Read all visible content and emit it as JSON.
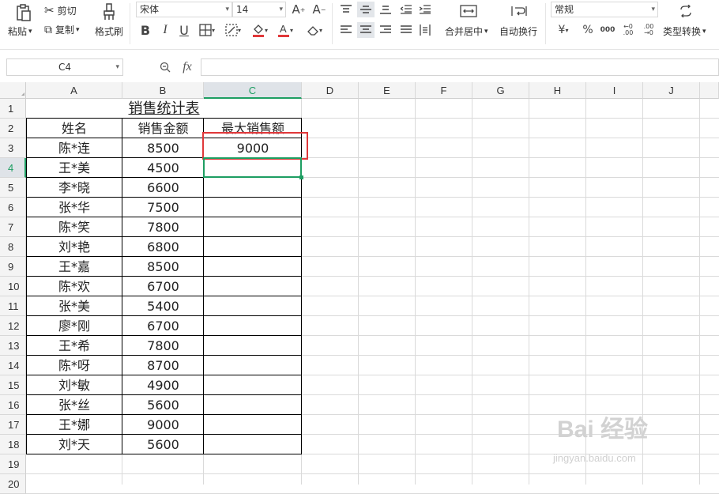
{
  "toolbar": {
    "paste": "粘贴",
    "cut": "剪切",
    "copy": "复制",
    "format_painter": "格式刷",
    "font_name": "宋体",
    "font_size": "14",
    "merge_center": "合并居中",
    "wrap_text": "自动换行",
    "number_format": "常规",
    "type_convert": "类型转换",
    "bold": "B",
    "italic": "I",
    "underline": "U",
    "currency": "¥",
    "percent": "%",
    "thousands": "000"
  },
  "formula_bar": {
    "name_box": "C4",
    "fx": "fx",
    "formula": ""
  },
  "columns": [
    "A",
    "B",
    "C",
    "D",
    "E",
    "F",
    "G",
    "H",
    "I",
    "J"
  ],
  "rows": [
    "1",
    "2",
    "3",
    "4",
    "5",
    "6",
    "7",
    "8",
    "9",
    "10",
    "11",
    "12",
    "13",
    "14",
    "15",
    "16",
    "17",
    "18",
    "19",
    "20"
  ],
  "sheet": {
    "title": "销售统计表",
    "headers": [
      "姓名",
      "销售金额",
      "最大销售额"
    ],
    "max_value": "9000",
    "data": [
      [
        "陈*连",
        "8500"
      ],
      [
        "王*美",
        "4500"
      ],
      [
        "李*晓",
        "6600"
      ],
      [
        "张*华",
        "7500"
      ],
      [
        "陈*笑",
        "7800"
      ],
      [
        "刘*艳",
        "6800"
      ],
      [
        "王*嘉",
        "8500"
      ],
      [
        "陈*欢",
        "6700"
      ],
      [
        "张*美",
        "5400"
      ],
      [
        "廖*刚",
        "6700"
      ],
      [
        "王*希",
        "7800"
      ],
      [
        "陈*呀",
        "8700"
      ],
      [
        "刘*敏",
        "4900"
      ],
      [
        "张*丝",
        "5600"
      ],
      [
        "王*娜",
        "9000"
      ],
      [
        "刘*天",
        "5600"
      ]
    ]
  },
  "selection": {
    "cell": "C4"
  },
  "watermark": {
    "brand": "Bai 经验",
    "url": "jingyan.baidu.com"
  }
}
